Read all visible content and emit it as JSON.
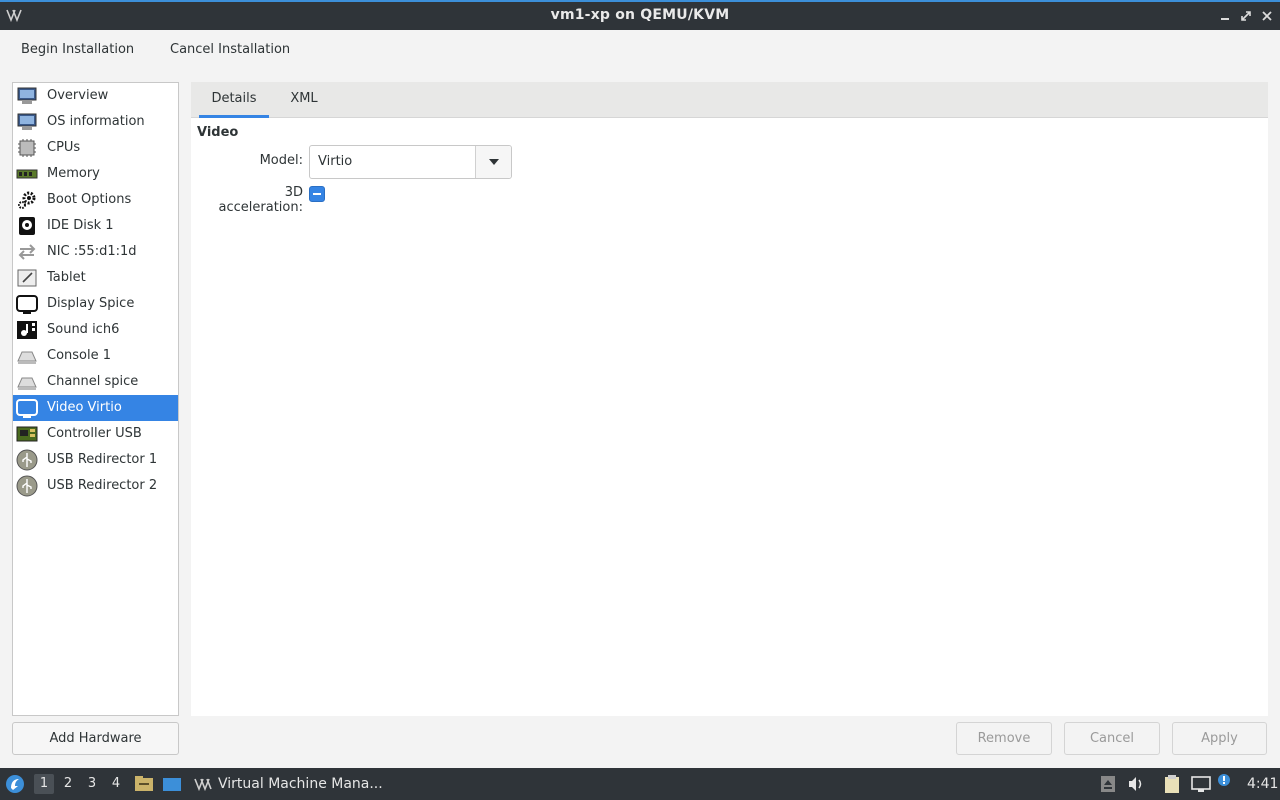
{
  "window": {
    "title": "vm1-xp on QEMU/KVM",
    "controls": [
      "minimize-icon",
      "maximize-icon",
      "close-icon"
    ]
  },
  "menubar": {
    "begin_label": "Begin Installation",
    "cancel_label": "Cancel Installation"
  },
  "sidebar": {
    "selected_index": 12,
    "items": [
      {
        "label": "Overview",
        "icon": "monitor-icon"
      },
      {
        "label": "OS information",
        "icon": "monitor-icon"
      },
      {
        "label": "CPUs",
        "icon": "cpu-icon"
      },
      {
        "label": "Memory",
        "icon": "memory-icon"
      },
      {
        "label": "Boot Options",
        "icon": "gear-icon"
      },
      {
        "label": "IDE Disk 1",
        "icon": "disk-icon"
      },
      {
        "label": "NIC :55:d1:1d",
        "icon": "network-icon"
      },
      {
        "label": "Tablet",
        "icon": "tablet-icon"
      },
      {
        "label": "Display Spice",
        "icon": "display-icon"
      },
      {
        "label": "Sound ich6",
        "icon": "sound-icon"
      },
      {
        "label": "Console 1",
        "icon": "console-icon"
      },
      {
        "label": "Channel spice",
        "icon": "channel-icon"
      },
      {
        "label": "Video Virtio",
        "icon": "video-icon"
      },
      {
        "label": "Controller USB",
        "icon": "controller-icon"
      },
      {
        "label": "USB Redirector 1",
        "icon": "usb-icon"
      },
      {
        "label": "USB Redirector 2",
        "icon": "usb-icon"
      }
    ]
  },
  "tabs": {
    "details": "Details",
    "xml": "XML",
    "active": "Details"
  },
  "video": {
    "section_title": "Video",
    "model_label": "Model:",
    "model_value": "Virtio",
    "accel_label": "3D acceleration:",
    "accel_state": "indeterminate"
  },
  "buttons": {
    "add_hardware": "Add Hardware",
    "remove": "Remove",
    "cancel": "Cancel",
    "apply": "Apply"
  },
  "taskbar": {
    "workspaces": [
      "1",
      "2",
      "3",
      "4"
    ],
    "active_workspace": "1",
    "task_label": "Virtual Machine Mana...",
    "clock": "4:41"
  },
  "colors": {
    "accent": "#3584e4",
    "titlebar": "#2f3439"
  }
}
